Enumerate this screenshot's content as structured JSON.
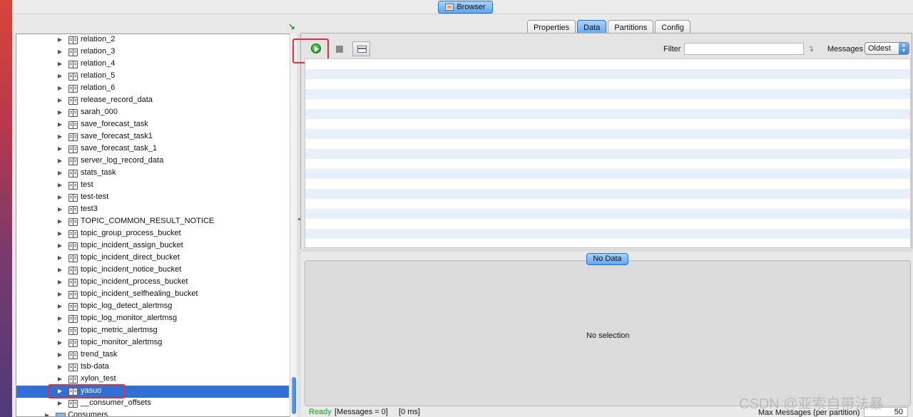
{
  "window": {
    "browser_tab": "Browser"
  },
  "tree": {
    "items": [
      {
        "label": "relation_2"
      },
      {
        "label": "relation_3"
      },
      {
        "label": "relation_4"
      },
      {
        "label": "relation_5"
      },
      {
        "label": "relation_6"
      },
      {
        "label": "release_record_data"
      },
      {
        "label": "sarah_000"
      },
      {
        "label": "save_forecast_task"
      },
      {
        "label": "save_forecast_task1"
      },
      {
        "label": "save_forecast_task_1"
      },
      {
        "label": "server_log_record_data"
      },
      {
        "label": "stats_task"
      },
      {
        "label": "test"
      },
      {
        "label": "test-test"
      },
      {
        "label": "test3"
      },
      {
        "label": "TOPIC_COMMON_RESULT_NOTICE"
      },
      {
        "label": "topic_group_process_bucket"
      },
      {
        "label": "topic_incident_assign_bucket"
      },
      {
        "label": "topic_incident_direct_bucket"
      },
      {
        "label": "topic_incident_notice_bucket"
      },
      {
        "label": "topic_incident_process_bucket"
      },
      {
        "label": "topic_incident_selfhealing_bucket"
      },
      {
        "label": "topic_log_detect_alertmsg"
      },
      {
        "label": "topic_log_monitor_alertmsg"
      },
      {
        "label": "topic_metric_alertmsg"
      },
      {
        "label": "topic_monitor_alertmsg"
      },
      {
        "label": "trend_task"
      },
      {
        "label": "tsb-data"
      },
      {
        "label": "xylon_test"
      },
      {
        "label": "yasuo",
        "selected": true
      },
      {
        "label": "__consumer_offsets"
      }
    ],
    "consumers_label": "Consumers"
  },
  "tabs": [
    "Properties",
    "Data",
    "Partitions",
    "Config"
  ],
  "active_tab": "Data",
  "toolbar": {
    "filter_label": "Filter",
    "filter_value": "",
    "messages_label": "Messages",
    "messages_selected": "Oldest"
  },
  "detail": {
    "badge": "No Data",
    "empty_text": "No selection"
  },
  "status": {
    "ready": "Ready",
    "messages": "[Messages = 0]",
    "time": "[0 ms]",
    "max_label": "Max Messages (per partition)",
    "max_value": "50"
  },
  "watermark": "CSDN @亚索自带法暴",
  "colors": {
    "accent": "#5fa6ef",
    "selection": "#2f6fd6",
    "highlight_box": "#e0303a",
    "ready": "#1a9a1a"
  }
}
